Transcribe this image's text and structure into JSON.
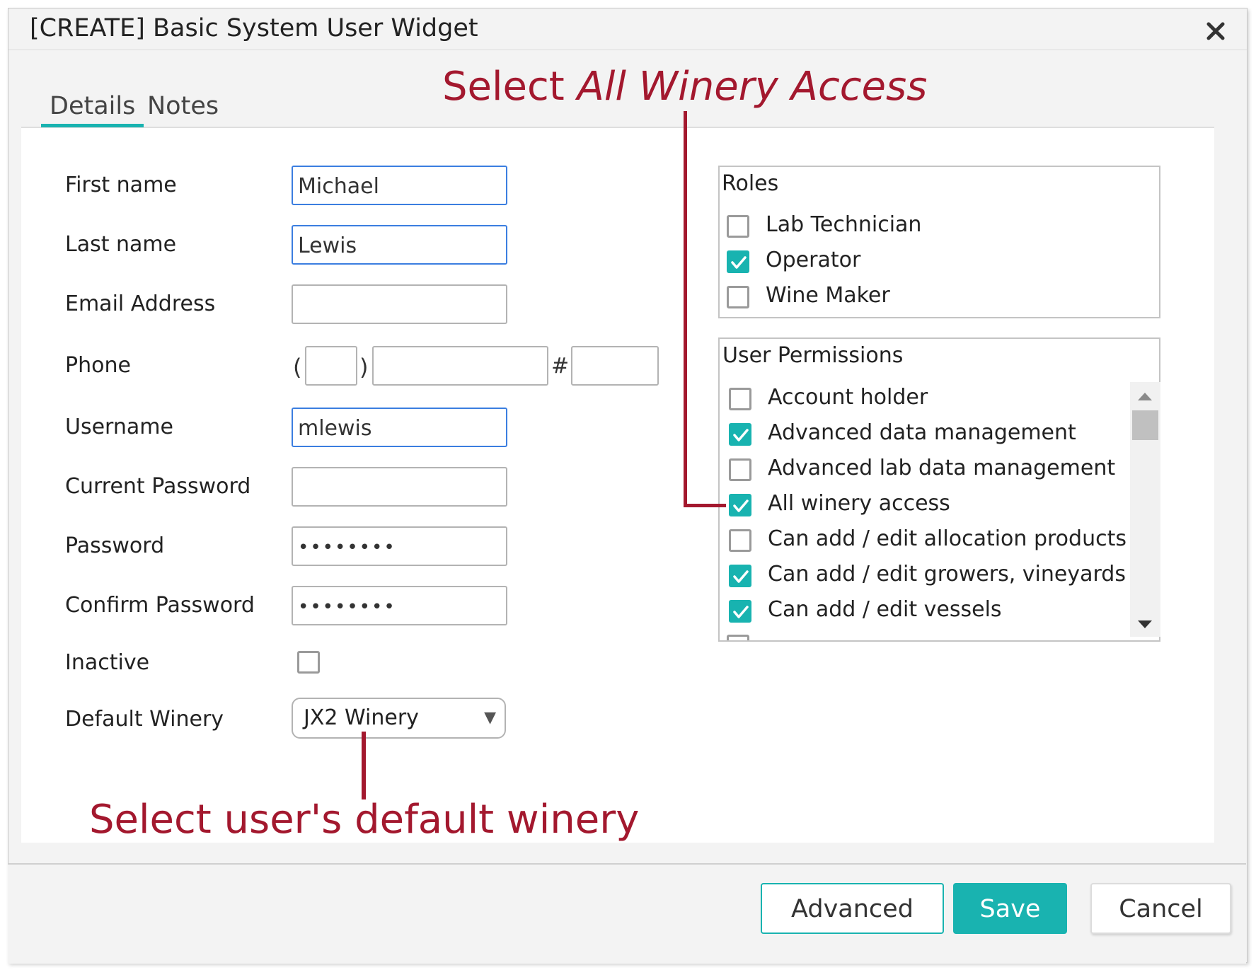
{
  "dialog": {
    "title": "[CREATE] Basic System User Widget"
  },
  "tabs": [
    {
      "label": "Details",
      "active": true
    },
    {
      "label": "Notes",
      "active": false
    }
  ],
  "form": {
    "first_name": {
      "label": "First name",
      "value": "Michael"
    },
    "last_name": {
      "label": "Last name",
      "value": "Lewis"
    },
    "email": {
      "label": "Email Address",
      "value": ""
    },
    "phone": {
      "label": "Phone",
      "open_paren": "(",
      "close_paren": ")",
      "ext_symbol": "#",
      "area": "",
      "number": "",
      "ext": ""
    },
    "username": {
      "label": "Username",
      "value": "mlewis"
    },
    "current_password": {
      "label": "Current Password",
      "value": ""
    },
    "password": {
      "label": "Password",
      "value": "••••••••"
    },
    "confirm_password": {
      "label": "Confirm Password",
      "value": "••••••••"
    },
    "inactive": {
      "label": "Inactive",
      "checked": false
    },
    "default_winery": {
      "label": "Default Winery",
      "value": "JX2 Winery"
    }
  },
  "roles": {
    "label": "Roles",
    "items": [
      {
        "label": "Lab Technician",
        "checked": false
      },
      {
        "label": "Operator",
        "checked": true
      },
      {
        "label": "Wine Maker",
        "checked": false
      }
    ]
  },
  "permissions": {
    "label": "User Permissions",
    "items": [
      {
        "label": "Account holder",
        "checked": false
      },
      {
        "label": "Advanced data management",
        "checked": true
      },
      {
        "label": "Advanced lab data management",
        "checked": false
      },
      {
        "label": "All winery access",
        "checked": true
      },
      {
        "label": "Can add / edit allocation products",
        "checked": false
      },
      {
        "label": "Can add / edit growers, vineyards",
        "checked": true
      },
      {
        "label": "Can add / edit vessels",
        "checked": true
      }
    ]
  },
  "annotations": {
    "top_prefix": "Select ",
    "top_emphasis": "All Winery Access",
    "bottom": "Select user's default winery"
  },
  "footer": {
    "advanced_label": "Advanced",
    "save_label": "Save",
    "cancel_label": "Cancel"
  },
  "colors": {
    "accent": "#19b3b0",
    "annotation": "#a3182e",
    "focus_border": "#3b7ee0"
  }
}
